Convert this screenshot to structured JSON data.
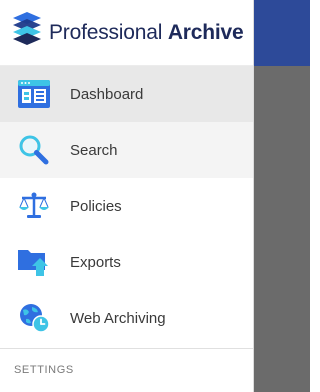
{
  "brand": {
    "name_light": "Professional",
    "name_bold": "Archive"
  },
  "nav": {
    "items": [
      {
        "id": "dashboard",
        "label": "Dashboard",
        "icon": "dashboard-icon",
        "state": "active"
      },
      {
        "id": "search",
        "label": "Search",
        "icon": "search-icon",
        "state": "hover"
      },
      {
        "id": "policies",
        "label": "Policies",
        "icon": "scales-icon",
        "state": "default"
      },
      {
        "id": "exports",
        "label": "Exports",
        "icon": "folder-upload-icon",
        "state": "default"
      },
      {
        "id": "web-archiving",
        "label": "Web Archiving",
        "icon": "globe-clock-icon",
        "state": "default"
      }
    ]
  },
  "settings": {
    "title": "SETTINGS"
  },
  "colors": {
    "brand_navy": "#1e2a5a",
    "accent_blue": "#2f6fe0",
    "accent_cyan": "#3ec4e6",
    "active_bg": "#e8e8e8",
    "hover_bg": "#f4f4f4",
    "topbar_blue": "#2d4a99",
    "overlay_gray": "#6b6b6b"
  }
}
